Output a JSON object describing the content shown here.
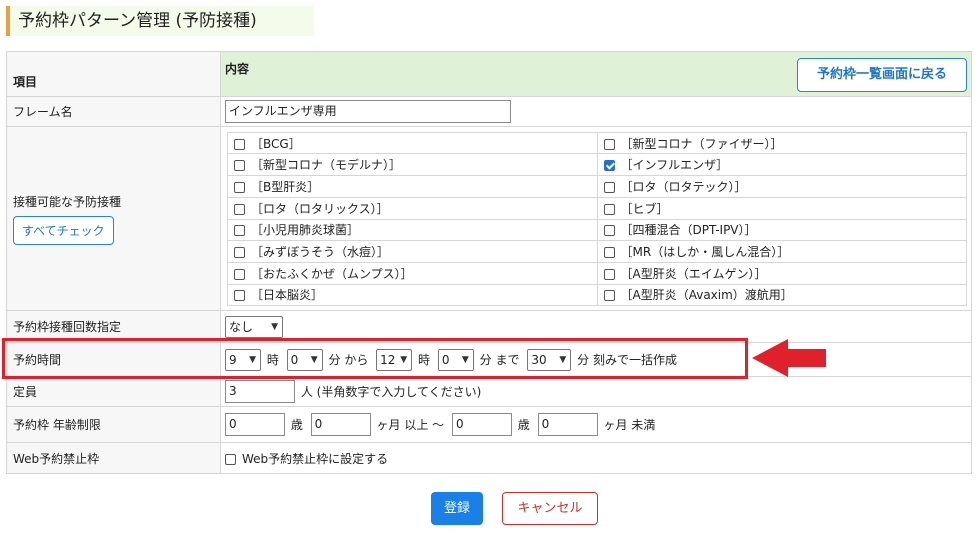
{
  "page": {
    "title": "予約枠パターン管理 (予防接種)"
  },
  "header": {
    "col_item": "項目",
    "col_content": "内容",
    "back_button": "予約枠一覧画面に戻る"
  },
  "frame_name": {
    "label": "フレーム名",
    "value": "インフルエンザ専用"
  },
  "vaccines": {
    "label": "接種可能な予防接種",
    "check_all_button": "すべてチェック",
    "left": [
      {
        "label": "［BCG］",
        "checked": false
      },
      {
        "label": "［新型コロナ（モデルナ）］",
        "checked": false
      },
      {
        "label": "［B型肝炎］",
        "checked": false
      },
      {
        "label": "［ロタ（ロタリックス）］",
        "checked": false
      },
      {
        "label": "［小児用肺炎球菌］",
        "checked": false
      },
      {
        "label": "［みずぼうそう（水痘）］",
        "checked": false
      },
      {
        "label": "［おたふくかぜ（ムンプス）］",
        "checked": false
      },
      {
        "label": "［日本脳炎］",
        "checked": false
      }
    ],
    "right": [
      {
        "label": "［新型コロナ（ファイザー）］",
        "checked": false
      },
      {
        "label": "［インフルエンザ］",
        "checked": true
      },
      {
        "label": "［ロタ（ロタテック）］",
        "checked": false
      },
      {
        "label": "［ヒブ］",
        "checked": false
      },
      {
        "label": "［四種混合（DPT-IPV）］",
        "checked": false
      },
      {
        "label": "［MR（はしか・風しん混合）］",
        "checked": false
      },
      {
        "label": "［A型肝炎（エイムゲン）］",
        "checked": false
      },
      {
        "label": "［A型肝炎（Avaxim）渡航用］",
        "checked": false
      }
    ]
  },
  "count_setting": {
    "label": "予約枠接種回数指定",
    "value": "なし"
  },
  "time": {
    "label": "予約時間",
    "start_hour": "9",
    "hour_unit1": "時",
    "start_min": "0",
    "min_from": "分 から",
    "end_hour": "12",
    "hour_unit2": "時",
    "end_min": "0",
    "min_to": "分 まで",
    "interval": "30",
    "interval_suffix": "分 刻みで一括作成"
  },
  "capacity": {
    "label": "定員",
    "value": "3",
    "suffix": "人 (半角数字で入力してください)"
  },
  "age_limit": {
    "label": "予約枠 年齢制限",
    "min_years": "0",
    "years_unit1": "歳",
    "min_months": "0",
    "months_suffix1": "ヶ月 以上 ～",
    "max_years": "0",
    "years_unit2": "歳",
    "max_months": "0",
    "months_suffix2": "ヶ月 未満"
  },
  "web_block": {
    "label": "Web予約禁止枠",
    "checkbox_label": "Web予約禁止枠に設定する",
    "checked": false
  },
  "actions": {
    "submit": "登録",
    "cancel": "キャンセル"
  },
  "colors": {
    "highlight": "#e0202a",
    "primary": "#1a7fe6",
    "danger": "#c9302c",
    "header_bg": "#dff2d8"
  }
}
